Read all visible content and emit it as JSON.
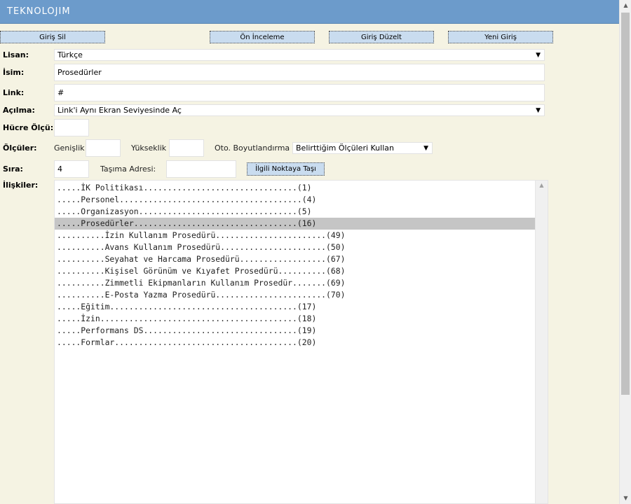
{
  "app": {
    "logo": "TEKNOLOJIM"
  },
  "toolbar": {
    "delete_label": "Giriş Sil",
    "preview_label": "Ön İnceleme",
    "edit_label": "Giriş Düzelt",
    "new_label": "Yeni Giriş"
  },
  "form": {
    "language": {
      "label": "Lisan:",
      "value": "Türkçe"
    },
    "name": {
      "label": "İsim:",
      "value": "Prosedürler"
    },
    "link": {
      "label": "Link:",
      "value": "#"
    },
    "open": {
      "label": "Açılma:",
      "value": "Link'i Aynı Ekran Seviyesinde Aç"
    },
    "cell_size": {
      "label": "Hücre Ölçü:",
      "value": ""
    },
    "dimensions": {
      "label": "Ölçüler:",
      "width_label": "Genişlik",
      "width_value": "",
      "height_label": "Yükseklik",
      "height_value": "",
      "autosize_label": "Oto. Boyutlandırma",
      "autosize_value": "Belirttiğim Ölçüleri Kullan"
    },
    "order": {
      "label": "Sıra:",
      "value": "4",
      "move_label": "Taşıma Adresi:",
      "move_value": "",
      "move_button": "İlgili Noktaya Taşı"
    },
    "relations": {
      "label": "İlişkiler:",
      "items": [
        ".....İK Politikası................................(1)",
        ".....Personel......................................(4)",
        ".....Organizasyon.................................(5)",
        ".....Prosedürler..................................(16)",
        "..........İzin Kullanım Prosedürü.......................(49)",
        "..........Avans Kullanım Prosedürü......................(50)",
        "..........Seyahat ve Harcama Prosedürü..................(67)",
        "..........Kişisel Görünüm ve Kıyafet Prosedürü..........(68)",
        "..........Zimmetli Ekipmanların Kullanım Prosedür.......(69)",
        "..........E-Posta Yazma Prosedürü.......................(70)",
        ".....Eğitim.......................................(17)",
        ".....İzin.........................................(18)",
        ".....Performans DS................................(19)",
        ".....Formlar......................................(20)"
      ],
      "selected_index": 3
    }
  }
}
